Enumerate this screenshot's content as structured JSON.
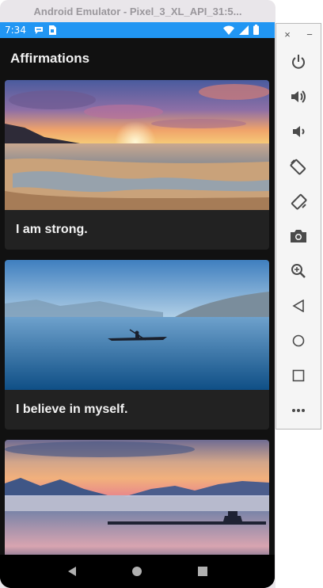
{
  "window": {
    "title": "Android Emulator - Pixel_3_XL_API_31:5..."
  },
  "status_bar": {
    "time": "7:34",
    "color": "#2196f3",
    "notification_icons": [
      "chat-bubble-icon",
      "sim-card-icon"
    ],
    "system_icons": [
      "wifi-icon",
      "cellular-signal-icon",
      "battery-icon"
    ]
  },
  "app": {
    "title": "Affirmations",
    "background": "#111111",
    "cards": [
      {
        "label": "I am strong.",
        "image": "beach-sunset-image"
      },
      {
        "label": "I believe in myself.",
        "image": "lake-kayak-image"
      },
      {
        "label": "",
        "image": "mountain-lake-sunset-image"
      }
    ]
  },
  "nav_bar": {
    "buttons": [
      "back-icon",
      "home-icon",
      "overview-icon"
    ]
  },
  "toolbar": {
    "close_label": "×",
    "minimize_label": "−",
    "buttons": [
      "power-icon",
      "volume-up-icon",
      "volume-down-icon",
      "rotate-left-icon",
      "rotate-right-icon",
      "camera-icon",
      "zoom-icon",
      "back-icon",
      "home-icon",
      "overview-icon",
      "more-icon"
    ]
  }
}
